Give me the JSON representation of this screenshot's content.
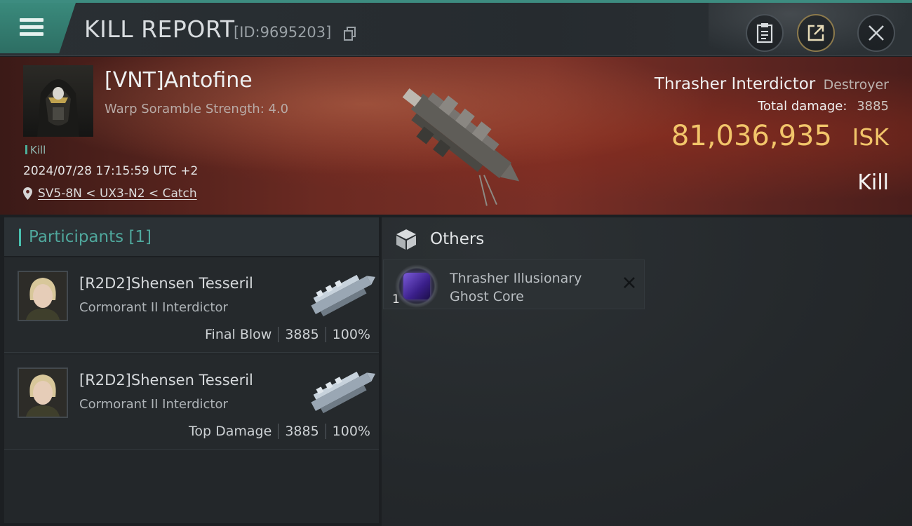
{
  "header": {
    "title": "KILL REPORT",
    "report_id": "[ID:9695203]"
  },
  "victim": {
    "name": "[VNT]Antofine",
    "warp_scramble": "Warp Soramble Strength: 4.0",
    "tag": "Kill",
    "datetime": "2024/07/28 17:15:59 UTC +2",
    "location": "SV5-8N < UX3-N2 < Catch",
    "ship_name": "Thrasher Interdictor",
    "ship_class": "Destroyer",
    "total_damage_label": "Total damage:",
    "total_damage": "3885",
    "isk_value": "81,036,935",
    "isk_unit": "ISK",
    "result": "Kill"
  },
  "participants": {
    "title": "Participants [1]",
    "rows": [
      {
        "name": "[R2D2]Shensen Tesseril",
        "ship": "Cormorant II Interdictor",
        "role": "Final Blow",
        "damage": "3885",
        "percent": "100%"
      },
      {
        "name": "[R2D2]Shensen Tesseril",
        "ship": "Cormorant II Interdictor",
        "role": "Top Damage",
        "damage": "3885",
        "percent": "100%"
      }
    ]
  },
  "others": {
    "title": "Others",
    "items": [
      {
        "name_line1": "Thrasher Illusionary",
        "name_line2": "Ghost Core",
        "quantity": "1"
      }
    ]
  },
  "colors": {
    "accent_teal": "#3d8c80",
    "isk_gold": "#f2c56a",
    "participants_teal": "#4fa79c"
  },
  "icons": [
    "menu-icon",
    "copy-icon",
    "clipboard-icon",
    "share-icon",
    "close-icon",
    "location-pin-icon",
    "cube-icon",
    "item-gem-icon",
    "x-mark-icon"
  ]
}
